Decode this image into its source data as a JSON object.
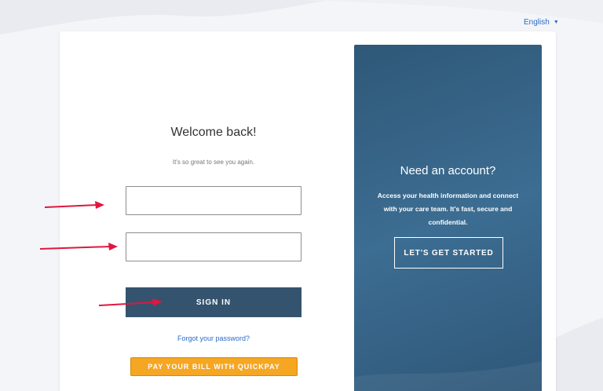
{
  "header": {
    "language": "English"
  },
  "login": {
    "title": "Welcome back!",
    "subtitle": "It's so great to see you again.",
    "username_placeholder": "",
    "password_placeholder": "",
    "sign_in_label": "SIGN IN",
    "forgot_label": "Forgot your password?",
    "quickpay_label": "PAY YOUR BILL WITH QUICKPAY"
  },
  "signup": {
    "title": "Need an account?",
    "description": "Access your health information and connect with your care team. It's fast, secure and confidential.",
    "cta_label": "LET'S GET STARTED"
  },
  "colors": {
    "panel": "#34536e",
    "accent_button": "#f5a623",
    "link": "#2a6cc7",
    "annotation_arrow": "#e0173f"
  },
  "icons": [
    "chevron-down-icon",
    "arrow-icon"
  ]
}
